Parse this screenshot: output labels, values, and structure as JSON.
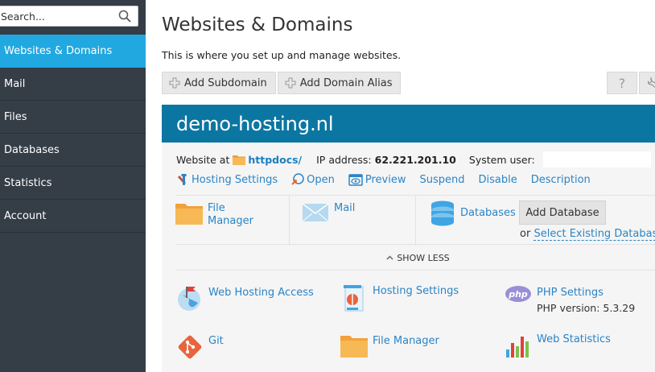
{
  "sidebar": {
    "search_placeholder": "Search...",
    "items": [
      {
        "label": "Websites & Domains"
      },
      {
        "label": "Mail"
      },
      {
        "label": "Files"
      },
      {
        "label": "Databases"
      },
      {
        "label": "Statistics"
      },
      {
        "label": "Account"
      }
    ]
  },
  "main": {
    "title": "Websites & Domains",
    "description": "This is where you set up and manage websites.",
    "toolbar": {
      "add_subdomain": "Add Subdomain",
      "add_domain_alias": "Add Domain Alias",
      "help": "?"
    }
  },
  "domain": {
    "name": "demo-hosting.nl",
    "website_at_label": "Website at",
    "docroot": "httpdocs/",
    "ip_label": "IP address:",
    "ip": "62.221.201.10",
    "sysuser_label": "System user:",
    "actions": {
      "hosting_settings": "Hosting Settings",
      "open": "Open",
      "preview": "Preview",
      "suspend": "Suspend",
      "disable": "Disable",
      "description": "Description"
    },
    "quick": {
      "file_manager_line1": "File",
      "file_manager_line2": "Manager",
      "mail": "Mail",
      "databases": "Databases",
      "add_database": "Add Database",
      "or": "or",
      "select_existing_db": "Select Existing Database"
    },
    "show_less": "SHOW LESS",
    "tools": {
      "web_hosting_access": "Web Hosting Access",
      "hosting_settings": "Hosting Settings",
      "php_settings": "PHP Settings",
      "php_version": "PHP version: 5.3.29",
      "php_badge": "php",
      "git": "Git",
      "file_manager": "File Manager",
      "web_statistics": "Web Statistics"
    }
  },
  "colors": {
    "sidebar_bg": "#353d47",
    "active_nav": "#21a8e0",
    "domain_header": "#0c76a2",
    "link": "#2b84c6"
  }
}
